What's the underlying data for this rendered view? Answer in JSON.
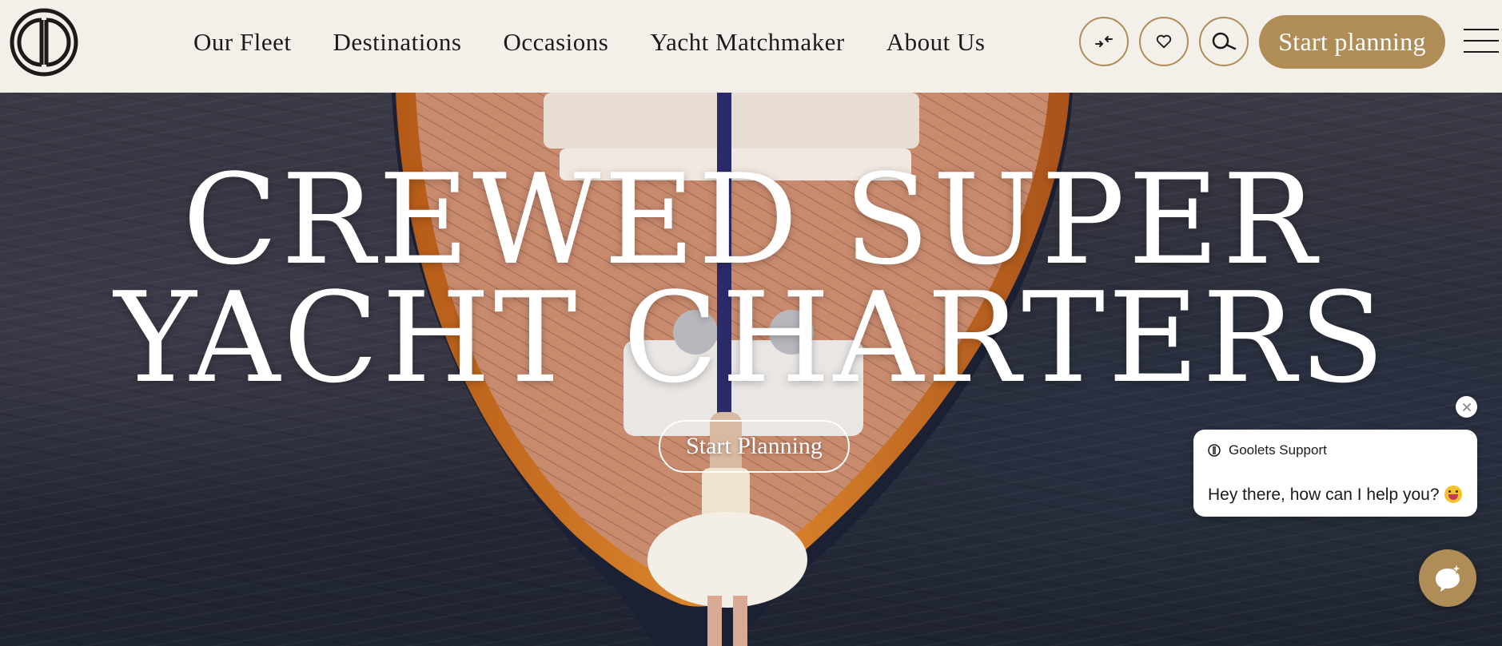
{
  "brand": {
    "logo_icon": "goolets-monogram-logo",
    "accent_color": "#b08d57",
    "bg_color": "#f3efe9"
  },
  "nav": {
    "items": [
      {
        "label": "Our Fleet"
      },
      {
        "label": "Destinations"
      },
      {
        "label": "Occasions"
      },
      {
        "label": "Yacht Matchmaker"
      },
      {
        "label": "About Us"
      }
    ]
  },
  "header_actions": {
    "compare_icon": "compare-arrows-icon",
    "favorites_icon": "heart-icon",
    "search_icon": "search-icon",
    "start_label": "Start planning",
    "menu_icon": "hamburger-menu-icon"
  },
  "hero": {
    "title_line1": "CREWED SUPER",
    "title_line2": "YACHT CHARTERS",
    "cta_label": "Start Planning"
  },
  "chat": {
    "agent_name": "Goolets Support",
    "message": "Hey there, how can I help you?",
    "emoji": "grinning-face-with-tongue-icon",
    "close_icon": "close-icon",
    "launcher_icon": "chat-sparkle-icon"
  }
}
